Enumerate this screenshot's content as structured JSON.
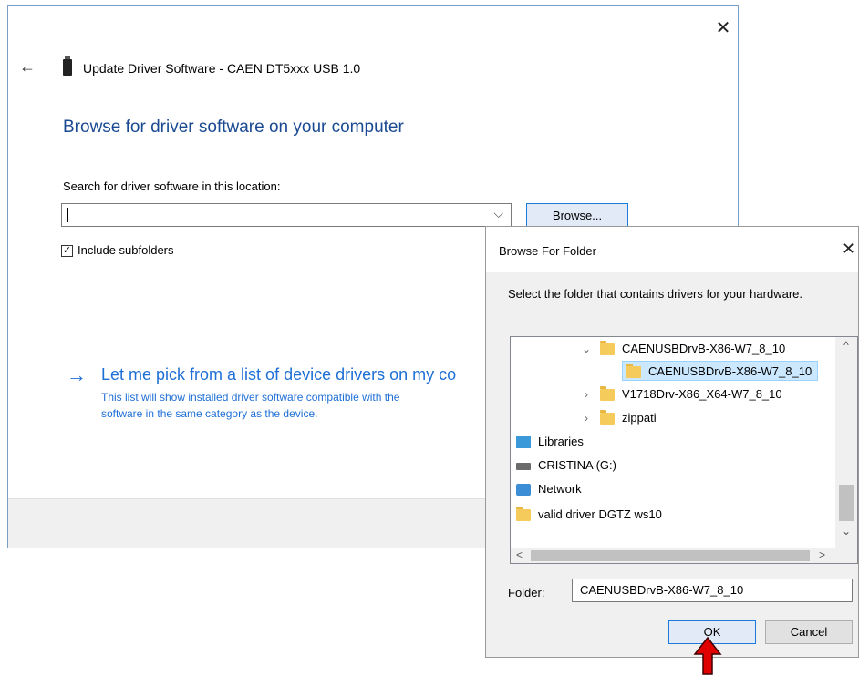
{
  "wizard": {
    "back_icon": "back-arrow-icon",
    "title": "Update Driver Software - CAEN DT5xxx USB 1.0",
    "heading": "Browse for driver software on your computer",
    "search_label": "Search for driver software in this location:",
    "path_value": "",
    "browse_label": "Browse...",
    "include_subfolders_label": "Include subfolders",
    "include_subfolders_checked": true,
    "pick_title": "Let me pick from a list of device drivers on my co",
    "pick_desc_line1": "This list will show installed driver software compatible with the",
    "pick_desc_line2": "software in the same category as the device.",
    "close_glyph": "✕",
    "back_glyph": "←",
    "arrow_glyph": "→",
    "check_glyph": "✓",
    "chevron_glyph": "⌵"
  },
  "browse_dialog": {
    "title": "Browse For Folder",
    "close_glyph": "✕",
    "instruction": "Select the folder that contains drivers for your hardware.",
    "tree": [
      {
        "label": "CAENUSBDrvB-X86-W7_8_10",
        "expander": "⌄",
        "icon": "folder-icon"
      },
      {
        "label": "CAENUSBDrvB-X86-W7_8_10",
        "expander": "",
        "icon": "folder-icon",
        "selected": true
      },
      {
        "label": "V1718Drv-X86_X64-W7_8_10",
        "expander": "›",
        "icon": "folder-icon"
      },
      {
        "label": "zippati",
        "expander": "›",
        "icon": "folder-icon"
      },
      {
        "label": "Libraries",
        "icon": "libraries-icon"
      },
      {
        "label": "CRISTINA (G:)",
        "icon": "drive-icon"
      },
      {
        "label": "Network",
        "icon": "network-icon"
      },
      {
        "label": "valid driver DGTZ ws10",
        "icon": "folder-icon"
      }
    ],
    "folder_label": "Folder:",
    "folder_value": "CAENUSBDrvB-X86-W7_8_10",
    "ok_label": "OK",
    "cancel_label": "Cancel",
    "scroll_up": "^",
    "scroll_down": "⌄",
    "scroll_left": "<",
    "scroll_right": ">"
  },
  "colors": {
    "accent": "#1e6fd6",
    "heading": "#1a4a92",
    "pointer_arrow": "#e00000"
  }
}
